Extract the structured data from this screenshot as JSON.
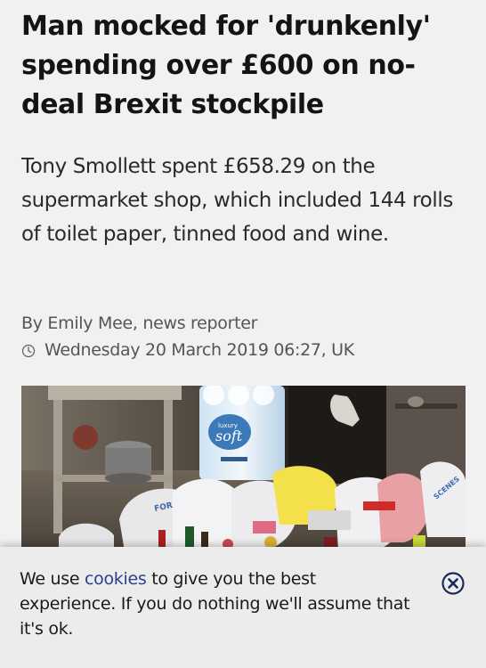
{
  "article": {
    "headline": "Man mocked for 'drunkenly' spending over £600 on no-deal Brexit stockpile",
    "standfirst": "Tony Smollett spent £658.29 on the supermarket shop, which included 144 rolls of toilet paper, tinned food and wine.",
    "byline": "By Emily Mee, news reporter",
    "timestamp": "Wednesday 20 March 2019 06:27, UK",
    "timestamp_icon": "clock-icon"
  },
  "photo": {
    "package_brand": "luxury",
    "package_label": "soft",
    "bag_label_left": "FOR",
    "bag_label_right": "SCENES"
  },
  "cookie_banner": {
    "text_before": "We use ",
    "link_text": "cookies",
    "text_after": " to give you the best experience. If you do nothing we'll assume that it's ok.",
    "close_icon": "close-circle-icon",
    "accent_color": "#2b3f8e"
  }
}
